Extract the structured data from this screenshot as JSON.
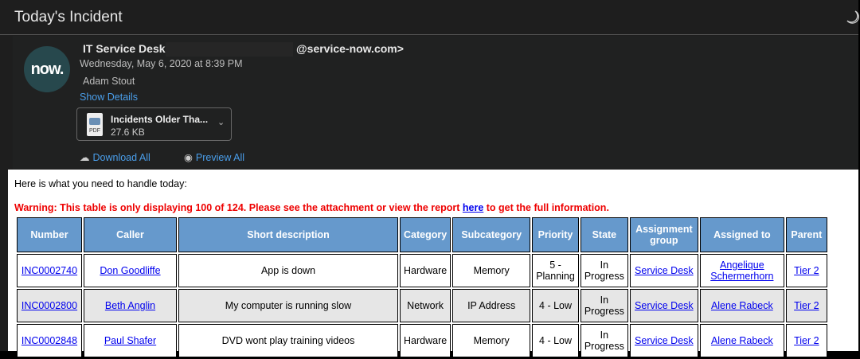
{
  "window": {
    "title": "Today's Incident"
  },
  "header": {
    "from_name": "IT Service Desk",
    "from_email": "@service-now.com>",
    "date": "Wednesday, May 6, 2020 at 8:39 PM",
    "to": "Adam Stout",
    "show_details": "Show Details",
    "avatar_text": "now.",
    "attachment": {
      "name": "Incidents Older Tha...",
      "size": "27.6 KB",
      "type": "PDF"
    },
    "download_all": "Download All",
    "preview_all": "Preview All"
  },
  "body": {
    "intro": "Here is what you need to handle today:",
    "warning_pre": "Warning: This table is only displaying 100 of 124. Please see the attachment or view the report ",
    "warning_link": "here",
    "warning_post": " to get the full information."
  },
  "table": {
    "headers": [
      "Number",
      "Caller",
      "Short description",
      "Category",
      "Subcategory",
      "Priority",
      "State",
      "Assignment group",
      "Assigned to",
      "Parent"
    ],
    "rows": [
      [
        "INC0002740",
        "Don Goodliffe",
        "App is down",
        "Hardware",
        "Memory",
        "5 - Planning",
        "In Progress",
        "Service Desk",
        "Angelique Schermerhorn",
        "Tier 2"
      ],
      [
        "INC0002800",
        "Beth Anglin",
        "My computer is running slow",
        "Network",
        "IP Address",
        "4 - Low",
        "In Progress",
        "Service Desk",
        "Alene Rabeck",
        "Tier 2"
      ],
      [
        "INC0002848",
        "Paul Shafer",
        "DVD wont play training videos",
        "Hardware",
        "Memory",
        "4 - Low",
        "In Progress",
        "Service Desk",
        "Alene Rabeck",
        "Tier 2"
      ]
    ]
  }
}
